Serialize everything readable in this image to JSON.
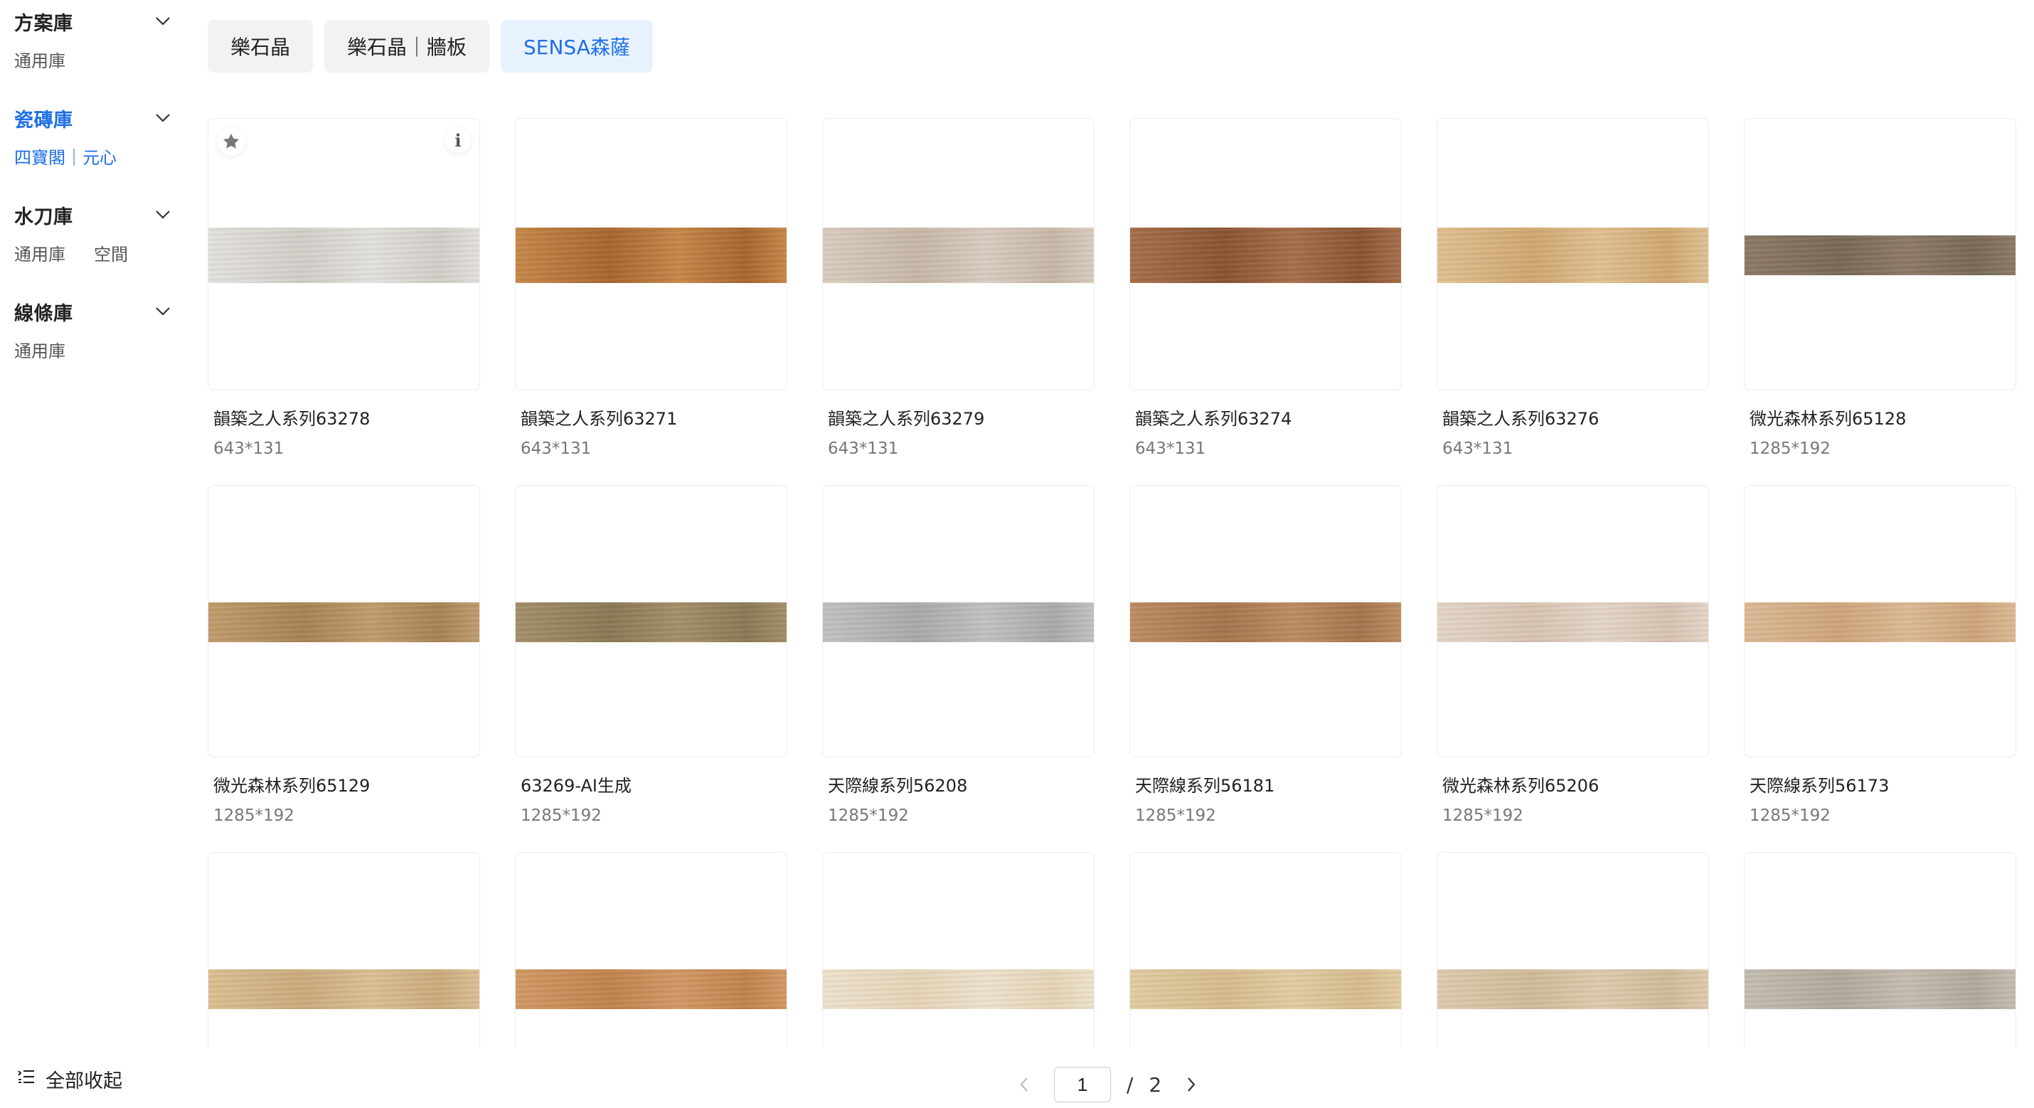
{
  "sidebar": {
    "categories": [
      {
        "title": "方案庫",
        "items": [
          "通用庫"
        ],
        "active": false
      },
      {
        "title": "瓷磚庫",
        "items": [
          "四寶閣｜元心"
        ],
        "active": true
      },
      {
        "title": "水刀庫",
        "items": [
          "通用庫",
          "空間"
        ],
        "active": false
      },
      {
        "title": "線條庫",
        "items": [
          "通用庫"
        ],
        "active": false
      }
    ],
    "collapse_all": "全部收起"
  },
  "tabs": [
    {
      "label": "樂石晶",
      "active": false
    },
    {
      "label": "樂石晶｜牆板",
      "active": false
    },
    {
      "label": "SENSA森薩",
      "active": true
    }
  ],
  "tiles": [
    {
      "name": "韻築之人系列63278",
      "size": "643*131",
      "color1": "#e6e4e0",
      "color2": "#d4d1cb"
    },
    {
      "name": "韻築之人系列63271",
      "size": "643*131",
      "color1": "#c9894a",
      "color2": "#a9672e"
    },
    {
      "name": "韻築之人系列63279",
      "size": "643*131",
      "color1": "#dccfc2",
      "color2": "#c9b9a8"
    },
    {
      "name": "韻築之人系列63274",
      "size": "643*131",
      "color1": "#a8714b",
      "color2": "#8a5533"
    },
    {
      "name": "韻築之人系列63276",
      "size": "643*131",
      "color1": "#e3c294",
      "color2": "#d2a971"
    },
    {
      "name": "微光森林系列65128",
      "size": "1285*192",
      "color1": "#8e7c66",
      "color2": "#7a6a55"
    },
    {
      "name": "微光森林系列65129",
      "size": "1285*192",
      "color1": "#c39e6e",
      "color2": "#a98455"
    },
    {
      "name": "63269-AI生成",
      "size": "1285*192",
      "color1": "#a6916a",
      "color2": "#8c7a55"
    },
    {
      "name": "天際線系列56208",
      "size": "1285*192",
      "color1": "#c4c4c4",
      "color2": "#ababab"
    },
    {
      "name": "天際線系列56181",
      "size": "1285*192",
      "color1": "#c08e64",
      "color2": "#a8764d"
    },
    {
      "name": "微光森林系列65206",
      "size": "1285*192",
      "color1": "#e7d8c9",
      "color2": "#d9c6b3"
    },
    {
      "name": "天際線系列56173",
      "size": "1285*192",
      "color1": "#dfbc97",
      "color2": "#cfa67c"
    },
    {
      "name": "",
      "size": "",
      "color1": "#ddc295",
      "color2": "#ccad7d"
    },
    {
      "name": "",
      "size": "",
      "color1": "#d59b66",
      "color2": "#c2844e"
    },
    {
      "name": "",
      "size": "",
      "color1": "#f2e5cf",
      "color2": "#e7d6b9"
    },
    {
      "name": "",
      "size": "",
      "color1": "#e5cfa6",
      "color2": "#d8bd8f"
    },
    {
      "name": "",
      "size": "",
      "color1": "#e1ceb1",
      "color2": "#d2bc9b"
    },
    {
      "name": "",
      "size": "",
      "color1": "#c8bfb4",
      "color2": "#b3aa9f"
    }
  ],
  "pagination": {
    "current": "1",
    "separator": "/",
    "total": "2"
  }
}
